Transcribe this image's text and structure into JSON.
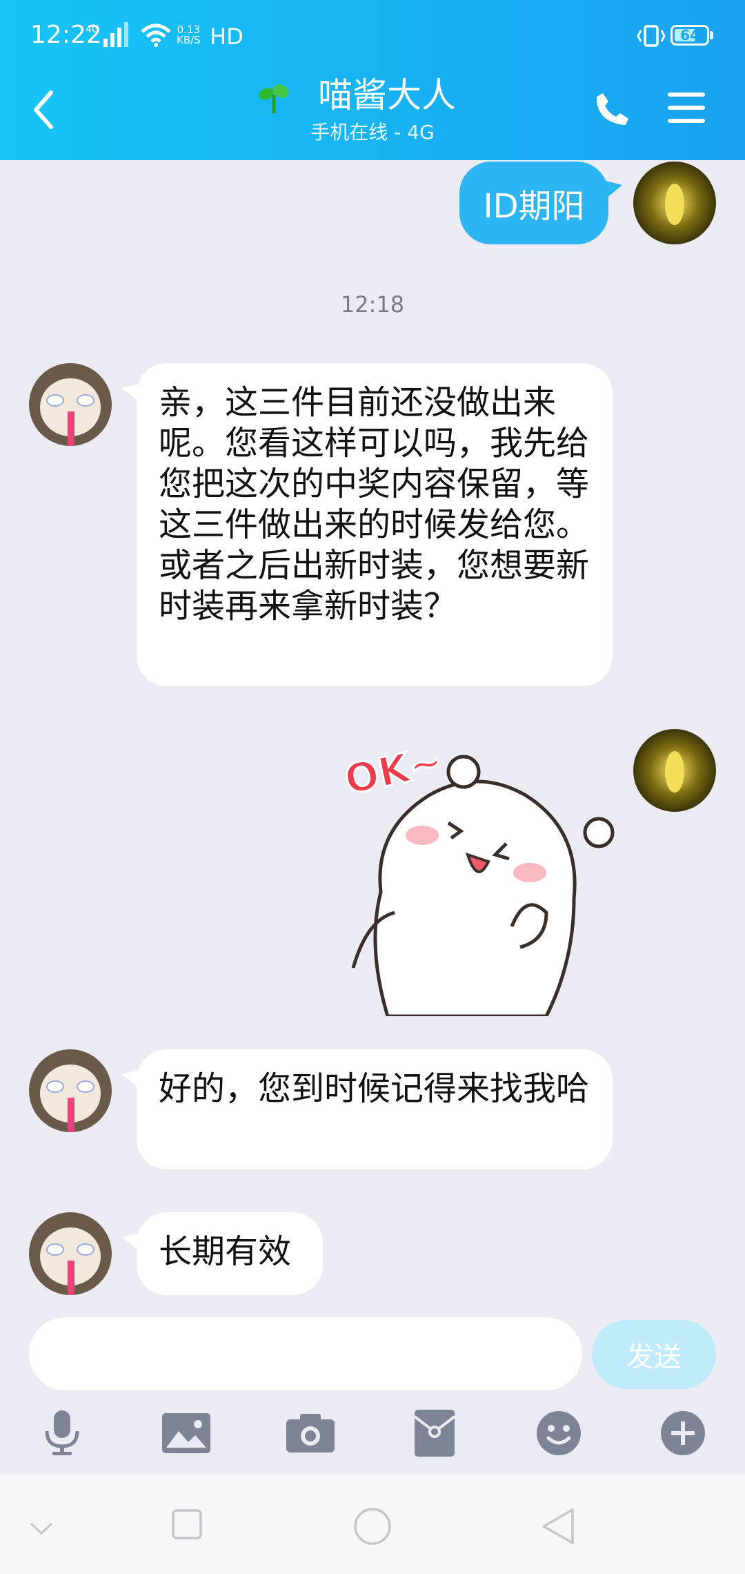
{
  "status": {
    "time": "12:22",
    "net": "4G",
    "speed_top": "0.13",
    "speed_bottom": "KB/S",
    "hd": "HD",
    "battery": "64"
  },
  "header": {
    "title": "喵酱大人",
    "subtitle": "手机在线 - 4G"
  },
  "messages": [
    {
      "from": "me",
      "text": "ID期阳"
    },
    {
      "from": "timestamp",
      "text": "12:18"
    },
    {
      "from": "other",
      "text": "亲，这三件目前还没做出来呢。您看这样可以吗，我先给您把这次的中奖内容保留，等这三件做出来的时候发给您。或者之后出新时装，您想要新时装再来拿新时装？"
    },
    {
      "from": "me",
      "sticker": "OK~"
    },
    {
      "from": "other",
      "text": "好的，您到时候记得来找我哈"
    },
    {
      "from": "other",
      "text": "长期有效"
    }
  ],
  "input": {
    "placeholder": "",
    "send_label": "发送"
  },
  "toolbar": [
    "microphone-icon",
    "image-icon",
    "camera-icon",
    "red-packet-icon",
    "emoji-icon",
    "plus-icon"
  ],
  "colors": {
    "header_start": "#16c4f6",
    "header_end": "#1aa2f0",
    "my_bubble": "#2db4f2",
    "background": "#eaebf3",
    "send_disabled": "#bfeafa",
    "toolbar_icon": "#7e8496"
  }
}
